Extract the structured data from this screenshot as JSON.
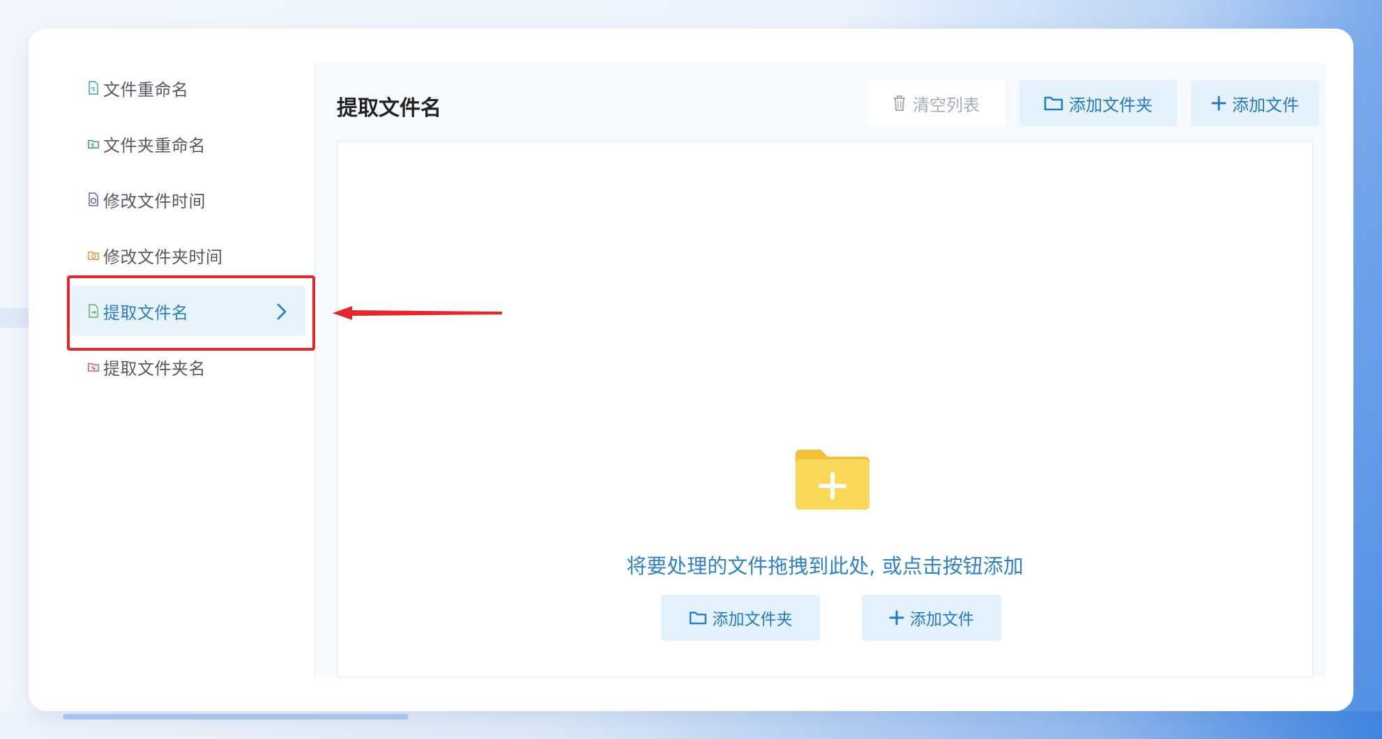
{
  "sidebar": {
    "items": [
      {
        "label": "文件重命名",
        "icon": "file-rename-icon",
        "color": "#3a9fc0"
      },
      {
        "label": "文件夹重命名",
        "icon": "folder-rename-icon",
        "color": "#2b8a7a"
      },
      {
        "label": "修改文件时间",
        "icon": "file-time-icon",
        "color": "#6a5fc0"
      },
      {
        "label": "修改文件夹时间",
        "icon": "folder-time-icon",
        "color": "#e08a2a"
      },
      {
        "label": "提取文件名",
        "icon": "extract-filename-icon",
        "color": "#5cb85c",
        "active": true
      },
      {
        "label": "提取文件夹名",
        "icon": "extract-foldername-icon",
        "color": "#d9406a"
      }
    ]
  },
  "main": {
    "title": "提取文件名",
    "toolbar": {
      "clear_label": "清空列表",
      "add_folder_label": "添加文件夹",
      "add_file_label": "添加文件"
    },
    "dropzone": {
      "hint": "将要处理的文件拖拽到此处, 或点击按钮添加",
      "add_folder_label": "添加文件夹",
      "add_file_label": "添加文件"
    }
  },
  "colors": {
    "accent": "#2579c0",
    "active_bg": "#e8f3fb",
    "highlight": "#e7262b",
    "folder": "#f7d24a"
  }
}
